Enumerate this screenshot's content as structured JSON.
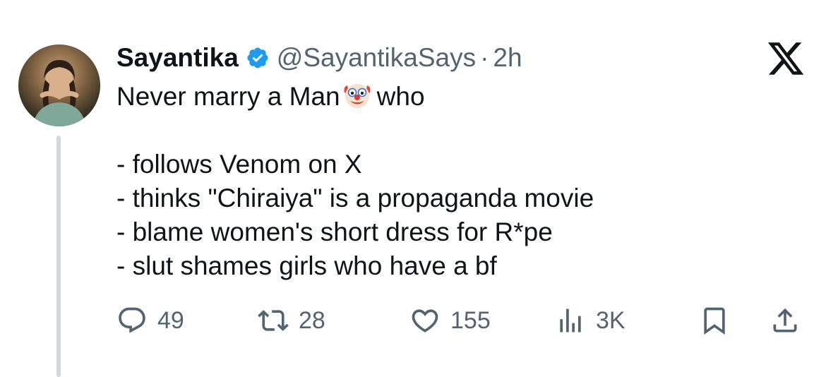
{
  "tweet": {
    "author_name": "Sayantika",
    "handle": "@SayantikaSays",
    "separator": "·",
    "time": "2h",
    "lines": [
      "Never marry a Man",
      "who",
      "",
      "- follows Venom on X",
      "- thinks \"Chiraiya\" is a propaganda movie",
      "- blame women's short dress for R*pe",
      "- slut shames girls who have a bf"
    ],
    "emoji": "clown-face"
  },
  "actions": {
    "replies": "49",
    "reposts": "28",
    "likes": "155",
    "views": "3K"
  },
  "colors": {
    "text": "#0f1419",
    "muted": "#536471",
    "verified": "#1d9bf0",
    "thread_line": "#cfd9de"
  }
}
